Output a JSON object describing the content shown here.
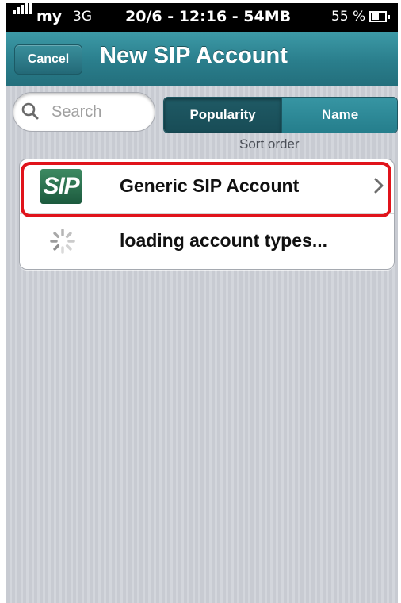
{
  "status_bar": {
    "carrier": "my",
    "network": "3G",
    "center_text": "20/6 - 12:16 - 54MB",
    "battery_percent": "55 %",
    "battery_level": 0.55
  },
  "nav": {
    "cancel_label": "Cancel",
    "title": "New SIP Account"
  },
  "search": {
    "placeholder": "Search"
  },
  "sort": {
    "options": [
      "Popularity",
      "Name"
    ],
    "selected": "Popularity",
    "caption": "Sort order"
  },
  "accounts": [
    {
      "icon_text": "SIP",
      "label": "Generic SIP Account",
      "icon": "sip-logo-icon",
      "disclosure": "chevron-right-icon"
    },
    {
      "label": "loading account types...",
      "icon": "loading-spinner-icon"
    }
  ],
  "colors": {
    "nav_bar": "#2a7e8c",
    "highlight": "#e0131b",
    "sip_logo": "#1c5a3e"
  }
}
